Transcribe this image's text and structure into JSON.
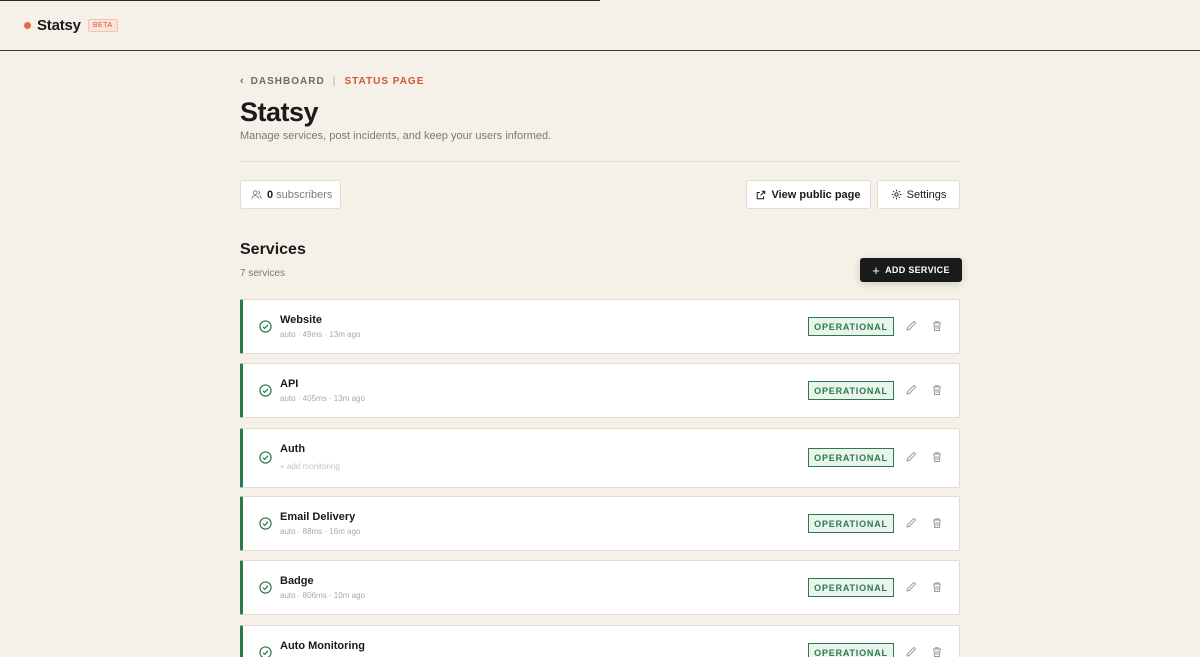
{
  "app": {
    "name": "Statsy",
    "beta_label": "BETA"
  },
  "breadcrumb": {
    "back_label": "DASHBOARD",
    "current_label": "STATUS PAGE"
  },
  "page": {
    "title": "Statsy",
    "subtitle": "Manage services, post incidents, and keep your users informed."
  },
  "toolbar": {
    "subscriber_count": "0",
    "subscriber_label": "subscribers",
    "view_public_label": "View public page",
    "settings_label": "Settings"
  },
  "services": {
    "title": "Services",
    "count_label": "7 services",
    "add_label": "ADD SERVICE",
    "status_color": "#2c7a4b",
    "items": [
      {
        "name": "Website",
        "meta": "auto · 49ms · 13m ago",
        "status": "OPERATIONAL"
      },
      {
        "name": "API",
        "meta": "auto · 405ms · 13m ago",
        "status": "OPERATIONAL"
      },
      {
        "name": "Auth",
        "meta": "+ add monitoring",
        "status": "OPERATIONAL"
      },
      {
        "name": "Email Delivery",
        "meta": "auto · 88ms · 16m ago",
        "status": "OPERATIONAL"
      },
      {
        "name": "Badge",
        "meta": "auto · 806ms · 10m ago",
        "status": "OPERATIONAL"
      },
      {
        "name": "Auto Monitoring",
        "meta": "",
        "status": "OPERATIONAL"
      }
    ]
  },
  "colors": {
    "background": "#f5f0e8",
    "accent": "#d4543a",
    "brand_dot": "#e8694a",
    "operational": "#2c7a4b"
  }
}
